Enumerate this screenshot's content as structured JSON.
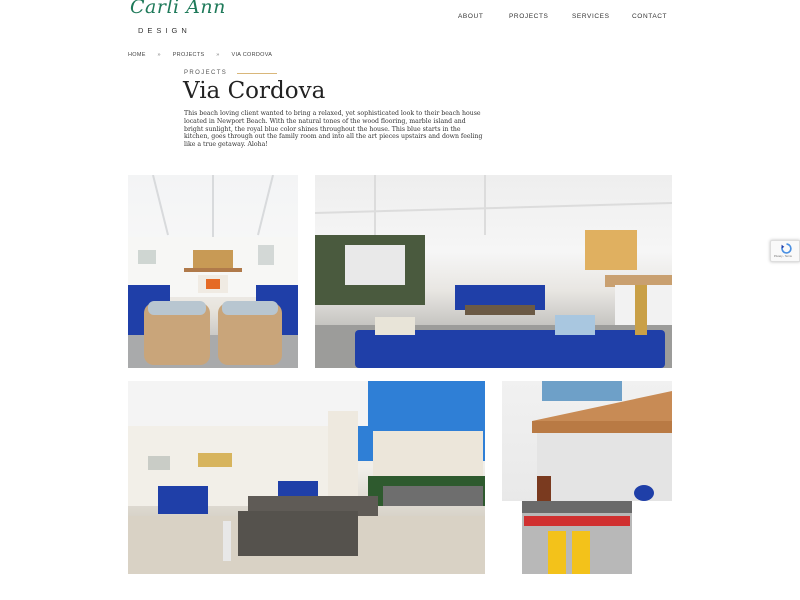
{
  "brand": {
    "logo_script": "Carli Ann",
    "logo_sub": "DESIGN"
  },
  "nav": {
    "items": [
      "ABOUT",
      "PROJECTS",
      "SERVICES",
      "CONTACT"
    ]
  },
  "breadcrumb": {
    "items": [
      "HOME",
      "PROJECTS",
      "VIA CORDOVA"
    ],
    "separator": "»"
  },
  "intro": {
    "eyebrow": "PROJECTS",
    "title": "Via Cordova",
    "description": "This beach loving client wanted to bring a relaxed, yet sophisticated look to their beach house located in Newport Beach. With the natural tones of the wood flooring, marble island and bright sunlight, the royal blue color shines throughout the house. This blue starts in the kitchen, goes through out the family room and into all the art pieces upstairs and down feeling like a true getaway. Aloha!"
  },
  "gallery": {
    "photos": [
      "living-room-wicker-chairs",
      "living-room-blue-sofa",
      "patio-dining",
      "kitchen-range"
    ]
  },
  "recaptcha": {
    "text": "Privacy - Terms"
  },
  "colors": {
    "accent_gold": "#d9b77a",
    "logo_green": "#1f7a5a",
    "royal_blue": "#1f3fa8"
  }
}
